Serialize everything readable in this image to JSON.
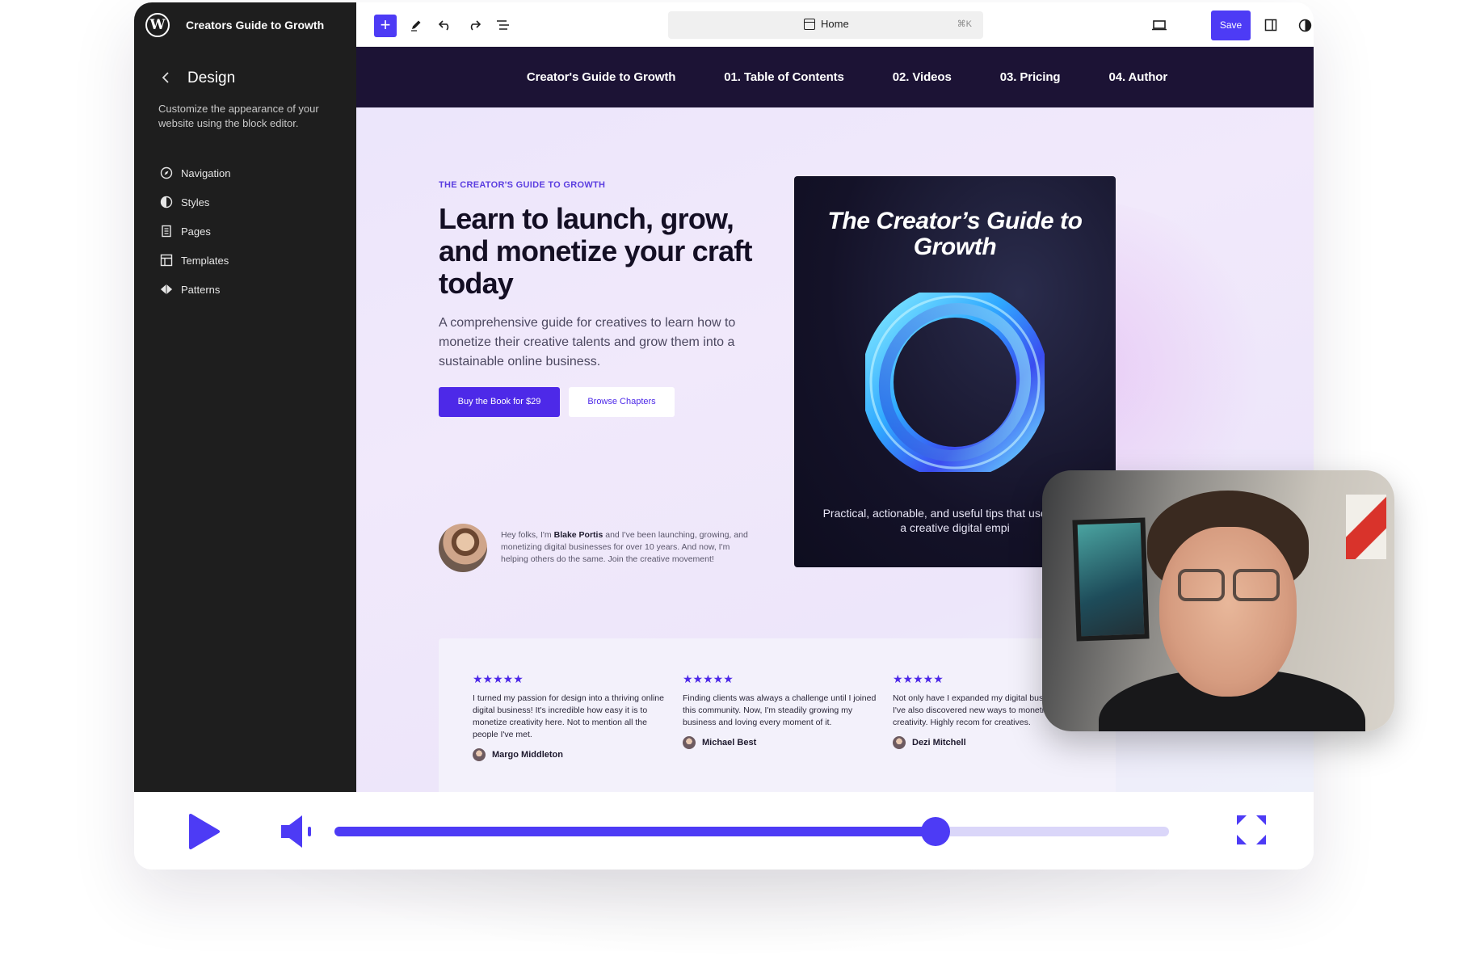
{
  "sidebar": {
    "site_title": "Creators Guide to Growth",
    "wp_logo": "W",
    "section_title": "Design",
    "description": "Customize the appearance of your website using the block editor.",
    "items": [
      {
        "label": "Navigation",
        "icon": "compass-icon"
      },
      {
        "label": "Styles",
        "icon": "half-circle-icon"
      },
      {
        "label": "Pages",
        "icon": "page-icon"
      },
      {
        "label": "Templates",
        "icon": "layout-icon"
      },
      {
        "label": "Patterns",
        "icon": "diamond-icon"
      }
    ]
  },
  "toolbar": {
    "page_label": "Home",
    "shortcut": "⌘K",
    "save_label": "Save",
    "accent": "#4d3bf5"
  },
  "site": {
    "nav": [
      "Creator's Guide to Growth",
      "01. Table of Contents",
      "02. Videos",
      "03. Pricing",
      "04. Author"
    ],
    "eyebrow": "THE CREATOR'S GUIDE TO GROWTH",
    "headline": "Learn to launch, grow, and monetize your craft today",
    "subhead": "A comprehensive guide for creatives to learn how to monetize their creative talents and grow them into a sustainable online business.",
    "buy_label": "Buy the Book for $29",
    "browse_label": "Browse Chapters",
    "author_pre": "Hey folks, I'm ",
    "author_name": "Blake Portis",
    "author_post": " and I've been launching, growing, and monetizing digital businesses for over 10 years. And now, I'm helping others do the same. Join the creative movement!",
    "book_title": "The Creator’s Guide to Growth",
    "book_tagline": "Practical, actionable, and useful tips that use to grow a creative digital empi",
    "testimonials": [
      {
        "stars": "★★★★★",
        "quote": "I turned my passion for design into a thriving online digital business! It's incredible how easy it is to monetize creativity here. Not to mention all the people I've met.",
        "name": "Margo Middleton"
      },
      {
        "stars": "★★★★★",
        "quote": "Finding clients was always a challenge until I joined this community. Now, I'm steadily growing my business and loving every moment of it.",
        "name": "Michael Best"
      },
      {
        "stars": "★★★★★",
        "quote": "Not only have I expanded my digital business, but I've also discovered new ways to monetize my creativity. Highly recom for creatives.",
        "name": "Dezi Mitchell"
      }
    ]
  },
  "player": {
    "progress_fraction": 0.72,
    "accent": "#4d3bf5",
    "track_color": "#dad6f9"
  }
}
